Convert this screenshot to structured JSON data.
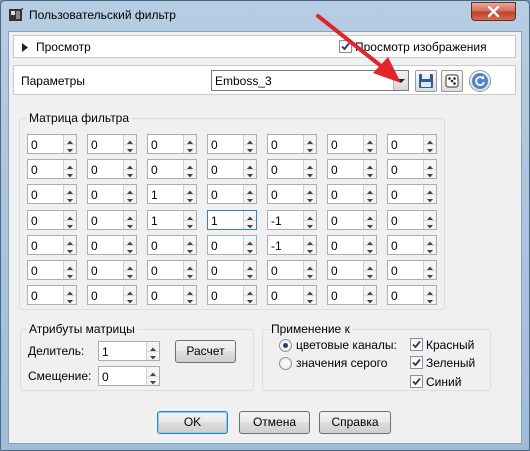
{
  "window": {
    "title": "Пользовательский фильтр"
  },
  "preview": {
    "label": "Просмотр",
    "image_preview_label": "Просмотр изображения",
    "image_preview_checked": true
  },
  "params": {
    "label": "Параметры",
    "preset": "Emboss_3"
  },
  "matrix": {
    "title": "Матрица фильтра",
    "rows": [
      [
        "0",
        "0",
        "0",
        "0",
        "0",
        "0",
        "0"
      ],
      [
        "0",
        "0",
        "0",
        "0",
        "0",
        "0",
        "0"
      ],
      [
        "0",
        "0",
        "1",
        "0",
        "0",
        "0",
        "0"
      ],
      [
        "0",
        "0",
        "1",
        "1",
        "-1",
        "0",
        "0"
      ],
      [
        "0",
        "0",
        "0",
        "0",
        "-1",
        "0",
        "0"
      ],
      [
        "0",
        "0",
        "0",
        "0",
        "0",
        "0",
        "0"
      ],
      [
        "0",
        "0",
        "0",
        "0",
        "0",
        "0",
        "0"
      ]
    ]
  },
  "attributes": {
    "title": "Атрибуты матрицы",
    "divisor_label": "Делитель:",
    "divisor": "1",
    "offset_label": "Смещение:",
    "offset": "0",
    "calc_button": "Расчет"
  },
  "apply": {
    "title": "Применение к",
    "color_channels": "цветовые каналы:",
    "gray_values": "значения серого",
    "selected": "color_channels",
    "red": "Красный",
    "green": "Зеленый",
    "blue": "Синий"
  },
  "buttons": {
    "ok": "OK",
    "cancel": "Отмена",
    "help": "Справка"
  },
  "colors": {
    "annotation_arrow": "#e0252c",
    "title_bar": "#a9c4df",
    "close_button": "#c9452c"
  }
}
